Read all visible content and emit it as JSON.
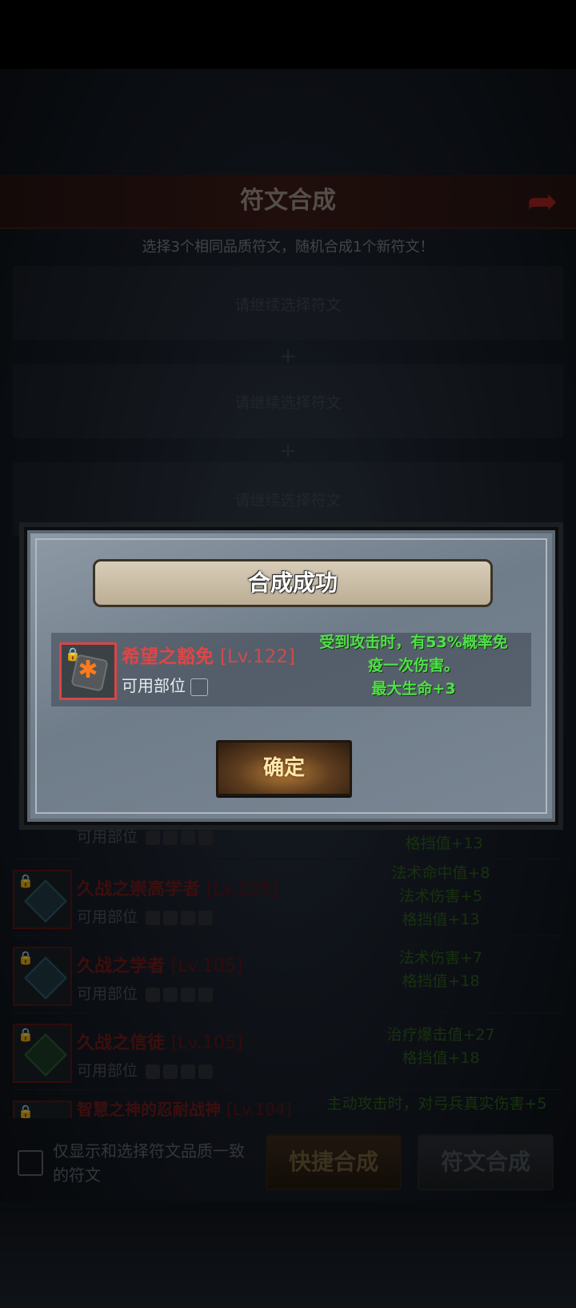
{
  "screen": {
    "title": "符文合成",
    "back_icon": "back-arrow-icon",
    "subtitle": "选择3个相同品质符文，随机合成1个新符文！",
    "slots": [
      "请继续选择符文",
      "请继续选择符文",
      "请继续选择符文"
    ],
    "slot_separator": "+"
  },
  "rune_list": {
    "slot_label": "可用部位",
    "items": [
      {
        "name": "久战之崇高学者",
        "level": "[Lv.105]",
        "stats": [
          "法术命中值+8",
          "法术伤害+5",
          "格挡值+13"
        ]
      },
      {
        "name": "久战之学者",
        "level": "[Lv.105]",
        "stats": [
          "法术伤害+7",
          "格挡值+18"
        ]
      },
      {
        "name": "久战之信徒",
        "level": "[Lv.105]",
        "stats": [
          "治疗爆击值+27",
          "格挡值+18"
        ]
      },
      {
        "name": "智慧之神的忍耐战神",
        "level": "[Lv.104]",
        "stats": [
          "主动攻击时，对弓兵真实伤害+5"
        ]
      }
    ],
    "partial_top_stats": [
      "法术命中值+8",
      "格挡值+13"
    ]
  },
  "bottom_bar": {
    "filter_label": "仅显示和选择符文品质一致的符文",
    "quick_button": "快捷合成",
    "compose_button": "符文合成"
  },
  "modal": {
    "title": "合成成功",
    "item": {
      "name": "希望之豁免",
      "level": "[Lv.122]",
      "slot_label": "可用部位",
      "rune_mark": "✱",
      "stats": [
        "受到攻击时，有53%概率免",
        "疫一次伤害。",
        "最大生命+3"
      ]
    },
    "confirm_button": "确定"
  },
  "colors": {
    "item_name": "#e34444",
    "stats_green": "#4fe04a",
    "confirm_text": "#ffe9b0"
  }
}
